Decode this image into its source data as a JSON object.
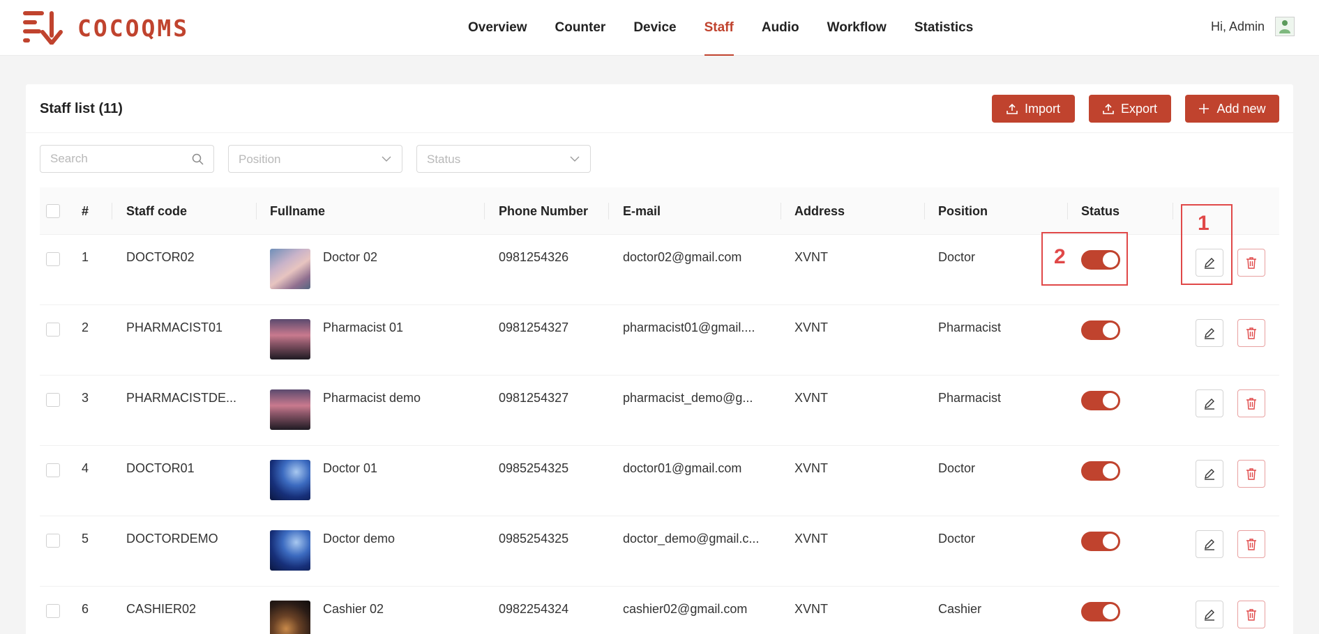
{
  "app": {
    "name": "COCOQMS"
  },
  "nav": [
    {
      "label": "Overview",
      "active": false
    },
    {
      "label": "Counter",
      "active": false
    },
    {
      "label": "Device",
      "active": false
    },
    {
      "label": "Staff",
      "active": true
    },
    {
      "label": "Audio",
      "active": false
    },
    {
      "label": "Workflow",
      "active": false
    },
    {
      "label": "Statistics",
      "active": false
    }
  ],
  "user": {
    "greeting": "Hi, Admin"
  },
  "card": {
    "title": "Staff list (11)",
    "import_label": "Import",
    "export_label": "Export",
    "add_label": "Add new"
  },
  "filters": {
    "search_placeholder": "Search",
    "position_placeholder": "Position",
    "status_placeholder": "Status"
  },
  "table": {
    "columns": [
      "#",
      "Staff code",
      "Fullname",
      "Phone Number",
      "E-mail",
      "Address",
      "Position",
      "Status"
    ],
    "rows": [
      {
        "index": "1",
        "code": "DOCTOR02",
        "name": "Doctor 02",
        "phone": "0981254326",
        "email": "doctor02@gmail.com",
        "address": "XVNT",
        "position": "Doctor",
        "status": true
      },
      {
        "index": "2",
        "code": "PHARMACIST01",
        "name": "Pharmacist 01",
        "phone": "0981254327",
        "email": "pharmacist01@gmail....",
        "address": "XVNT",
        "position": "Pharmacist",
        "status": true
      },
      {
        "index": "3",
        "code": "PHARMACISTDE...",
        "name": "Pharmacist demo",
        "phone": "0981254327",
        "email": "pharmacist_demo@g...",
        "address": "XVNT",
        "position": "Pharmacist",
        "status": true
      },
      {
        "index": "4",
        "code": "DOCTOR01",
        "name": "Doctor 01",
        "phone": "0985254325",
        "email": "doctor01@gmail.com",
        "address": "XVNT",
        "position": "Doctor",
        "status": true
      },
      {
        "index": "5",
        "code": "DOCTORDEMO",
        "name": "Doctor demo",
        "phone": "0985254325",
        "email": "doctor_demo@gmail.c...",
        "address": "XVNT",
        "position": "Doctor",
        "status": true
      },
      {
        "index": "6",
        "code": "CASHIER02",
        "name": "Cashier 02",
        "phone": "0982254324",
        "email": "cashier02@gmail.com",
        "address": "XVNT",
        "position": "Cashier",
        "status": true
      }
    ]
  },
  "annotations": {
    "callout1": "1",
    "callout2": "2"
  },
  "colors": {
    "accent": "#c0432e",
    "callout": "#e04848"
  }
}
